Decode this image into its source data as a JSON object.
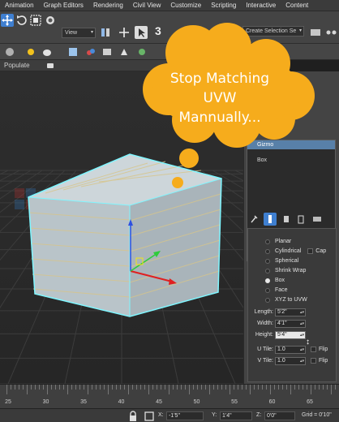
{
  "menu": [
    "Animation",
    "Graph Editors",
    "Rendering",
    "Civil View",
    "Customize",
    "Scripting",
    "Interactive",
    "Content"
  ],
  "toolbar": {
    "view_dropdown": "View",
    "selection_set_dropdown": "Create Selection Se",
    "snap_label": "3"
  },
  "ribbon": {
    "populate_label": "Populate"
  },
  "modifier_stack": {
    "items": [
      "Gizmo",
      "Box"
    ]
  },
  "panel": {
    "mapping_options": [
      "Planar",
      "Cylindrical",
      "Spherical",
      "Shrink Wrap",
      "Box",
      "Face",
      "XYZ to UVW"
    ],
    "selected_mapping": "Box",
    "cap_label": "Cap",
    "length": {
      "label": "Length:",
      "value": "5'2\""
    },
    "width": {
      "label": "Width:",
      "value": "4'1\""
    },
    "height": {
      "label": "Height:",
      "value": "5'4\""
    },
    "u_tile": {
      "label": "U Tile:",
      "value": "1.0"
    },
    "v_tile": {
      "label": "V Tile:",
      "value": "1.0"
    },
    "flip_label": "Flip"
  },
  "timeline": {
    "ticks": [
      "25",
      "30",
      "35",
      "40",
      "45",
      "50",
      "55",
      "60",
      "65"
    ]
  },
  "status": {
    "x_label": "X:",
    "x_value": "-1'5\"",
    "y_label": "Y:",
    "y_value": "1'4\"",
    "z_label": "Z:",
    "z_value": "0'0\"",
    "grid_label": "Grid = 0'10\""
  },
  "callout": {
    "line1": "Stop Matching",
    "line2": "UVW",
    "line3": "Mannually..."
  },
  "colors": {
    "callout_orange": "#f6ac1c",
    "selection_cyan": "#7ff6ff",
    "box_face": "#b9c4c9"
  }
}
